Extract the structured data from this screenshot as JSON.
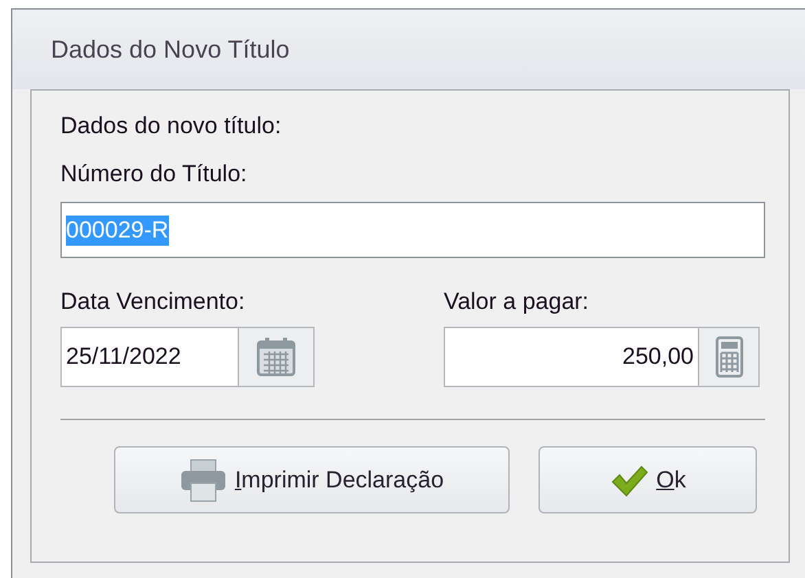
{
  "window": {
    "title": "Dados do Novo Título"
  },
  "heading": "Dados do novo título:",
  "number_field": {
    "label": "Número do Título:",
    "value": "000029-R",
    "text_selected": true
  },
  "due_date_field": {
    "label": "Data Vencimento:",
    "value": "25/11/2022"
  },
  "amount_field": {
    "label": "Valor a pagar:",
    "value": "250,00"
  },
  "buttons": [
    {
      "kind": "print",
      "label": "Imprimir Declaração",
      "mnemonic": true
    },
    {
      "kind": "ok",
      "label": "Ok",
      "mnemonic": true
    }
  ]
}
